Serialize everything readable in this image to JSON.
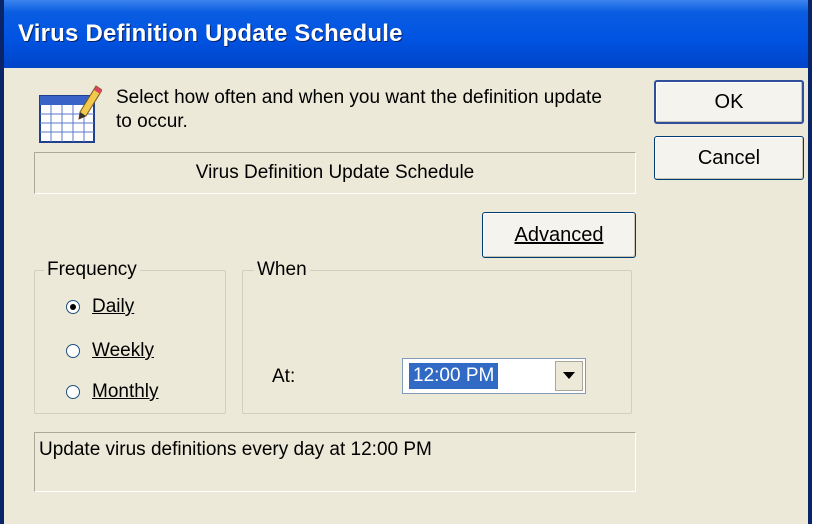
{
  "window": {
    "title": "Virus Definition Update Schedule"
  },
  "header": {
    "description": "Select how often and when you want the definition update to occur.",
    "banner": "Virus Definition Update Schedule"
  },
  "buttons": {
    "ok": "OK",
    "cancel": "Cancel",
    "advanced": "Advanced"
  },
  "frequency": {
    "legend": "Frequency",
    "options": [
      {
        "label": "Daily",
        "selected": true
      },
      {
        "label": "Weekly",
        "selected": false
      },
      {
        "label": "Monthly",
        "selected": false
      }
    ]
  },
  "when": {
    "legend": "When",
    "at_label": "At:",
    "time_value": "12:00 PM"
  },
  "summary": {
    "text": "Update virus definitions every day at 12:00 PM"
  },
  "colors": {
    "titlebar": "#0054e3",
    "dialog_bg": "#ece9d8",
    "selection": "#316ac5"
  },
  "icons": {
    "header_icon": "calendar-pencil-icon",
    "dropdown": "chevron-down-icon"
  }
}
